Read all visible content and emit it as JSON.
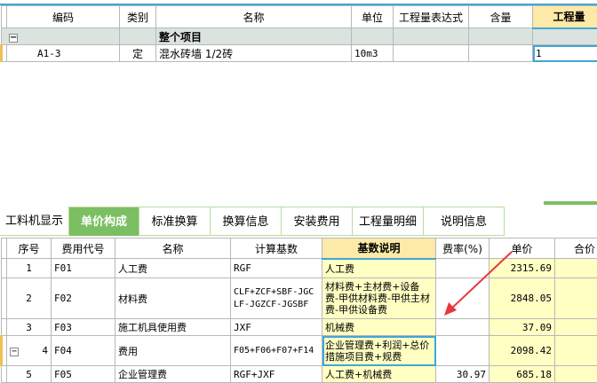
{
  "top_table": {
    "headers": [
      "编码",
      "类别",
      "名称",
      "单位",
      "工程量表达式",
      "含量",
      "工程量"
    ],
    "group": {
      "label": "整个项目",
      "toggle": "−"
    },
    "rows": [
      {
        "code": "A1-3",
        "type": "定",
        "name": "混水砖墙 1/2砖",
        "unit": "10m3",
        "expr": "",
        "content": "",
        "qty": "1"
      }
    ]
  },
  "tabs": [
    "工料机显示",
    "单价构成",
    "标准换算",
    "换算信息",
    "安装费用",
    "工程量明细",
    "说明信息"
  ],
  "bottom_table": {
    "headers": [
      "序号",
      "费用代号",
      "名称",
      "计算基数",
      "基数说明",
      "费率(%)",
      "单价",
      "合价"
    ],
    "rows": [
      {
        "no": "1",
        "code": "F01",
        "name": "人工费",
        "base": "RGF",
        "desc": "人工费",
        "rate": "",
        "price": "2315.69"
      },
      {
        "no": "2",
        "code": "F02",
        "name": "材料费",
        "base": "CLF+ZCF+SBF-JGCLF-JGZCF-JGSBF",
        "desc": "材料费+主材费+设备费-甲供材料费-甲供主材费-甲供设备费",
        "rate": "",
        "price": "2848.05"
      },
      {
        "no": "3",
        "code": "F03",
        "name": "施工机具使用费",
        "base": "JXF",
        "desc": "机械费",
        "rate": "",
        "price": "37.09"
      },
      {
        "no": "4",
        "code": "F04",
        "name": "费用",
        "base": "F05+F06+F07+F14",
        "desc": "企业管理费+利润+总价措施项目费+规费",
        "rate": "",
        "price": "2098.42",
        "toggle": "−"
      },
      {
        "no": "5",
        "code": "F05",
        "name": "企业管理费",
        "base": "RGF+JXF",
        "desc": "人工费+机械费",
        "rate": "30.97",
        "price": "685.18"
      }
    ]
  }
}
